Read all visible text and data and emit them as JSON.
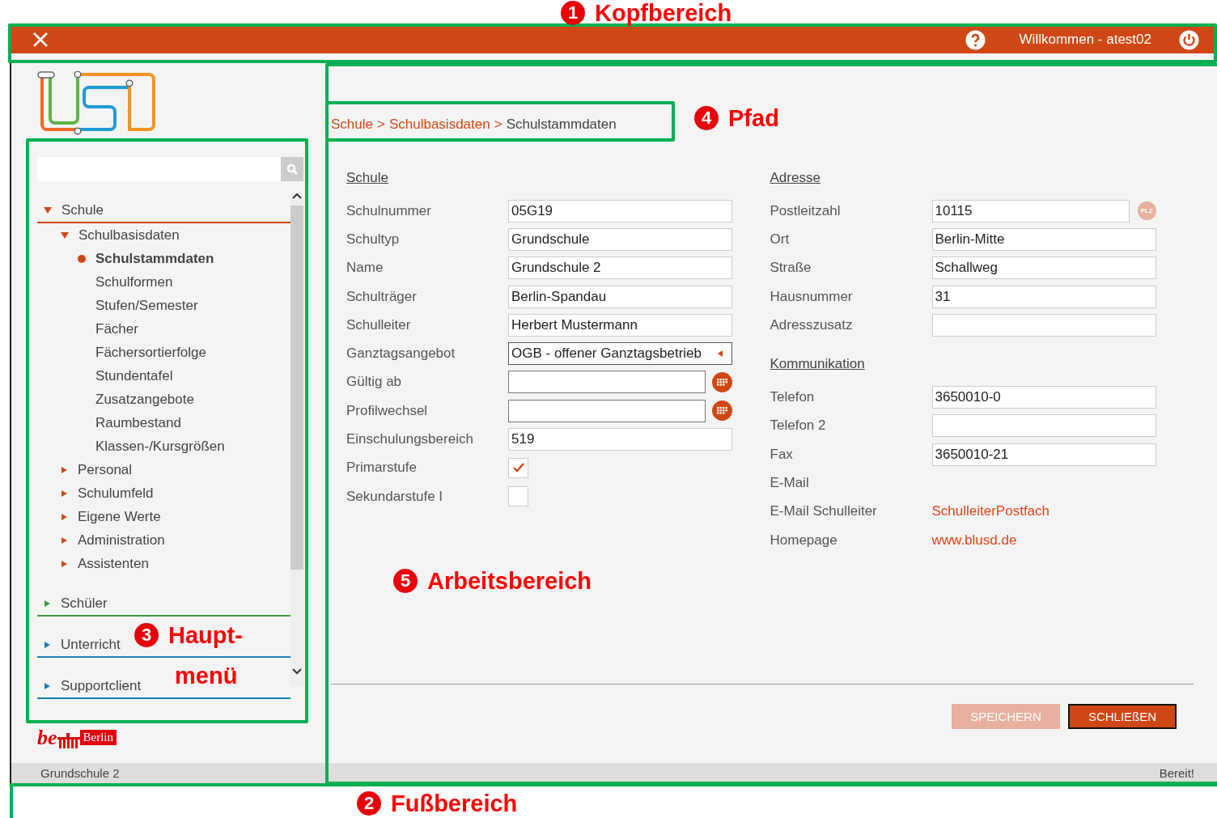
{
  "header": {
    "welcome": "Willkommen - atest02"
  },
  "sidebar": {
    "tree": [
      {
        "label": "Schule",
        "color": "#d04716",
        "expanded": true,
        "selected": false,
        "children": [
          {
            "label": "Schulbasisdaten",
            "expanded": true,
            "selected": false,
            "children": [
              {
                "label": "Schulstammdaten",
                "selected": true
              },
              {
                "label": "Schulformen",
                "selected": false
              },
              {
                "label": "Stufen/Semester",
                "selected": false
              },
              {
                "label": "Fächer",
                "selected": false
              },
              {
                "label": "Fächersortierfolge",
                "selected": false
              },
              {
                "label": "Stundentafel",
                "selected": false
              },
              {
                "label": "Zusatzangebote",
                "selected": false
              },
              {
                "label": "Raumbestand",
                "selected": false
              },
              {
                "label": "Klassen-/Kursgrößen",
                "selected": false
              }
            ]
          },
          {
            "label": "Personal",
            "expanded": false,
            "selected": false
          },
          {
            "label": "Schulumfeld",
            "expanded": false,
            "selected": false
          },
          {
            "label": "Eigene Werte",
            "expanded": false,
            "selected": false
          },
          {
            "label": "Administration",
            "expanded": false,
            "selected": false
          },
          {
            "label": "Assistenten",
            "expanded": false,
            "selected": false
          }
        ]
      },
      {
        "label": "Schüler",
        "color": "#3a9a3f",
        "expanded": false,
        "selected": false
      },
      {
        "label": "Unterricht",
        "color": "#1a7fad",
        "expanded": false,
        "selected": false
      },
      {
        "label": "Supportclient",
        "color": "#1a7fad",
        "expanded": false,
        "selected": false
      }
    ],
    "berlin_logo": {
      "mark": "be",
      "text": "Berlin"
    }
  },
  "breadcrumb": {
    "separator": ">",
    "items": [
      {
        "label": "Schule",
        "current": false
      },
      {
        "label": "Schulbasisdaten",
        "current": false
      },
      {
        "label": "Schulstammdaten",
        "current": true
      }
    ]
  },
  "form": {
    "columns": [
      {
        "sections": [
          {
            "heading": "Schule",
            "fields": [
              {
                "kind": "text",
                "label": "Schulnummer",
                "value": "05G19"
              },
              {
                "kind": "text",
                "label": "Schultyp",
                "value": "Grundschule"
              },
              {
                "kind": "text",
                "label": "Name",
                "value": "Grundschule 2"
              },
              {
                "kind": "text",
                "label": "Schulträger",
                "value": "Berlin-Spandau"
              },
              {
                "kind": "text",
                "label": "Schulleiter",
                "value": "Herbert Mustermann"
              },
              {
                "kind": "select",
                "label": "Ganztagsangebot",
                "value": "OGB - offener Ganztagsbetrieb"
              },
              {
                "kind": "date",
                "label": "Gültig ab"
              },
              {
                "kind": "date",
                "label": "Profilwechsel"
              },
              {
                "kind": "text",
                "label": "Einschulungsbereich",
                "value": "519"
              },
              {
                "kind": "checkbox",
                "label": "Primarstufe",
                "checked": true
              },
              {
                "kind": "checkbox",
                "label": "Sekundarstufe I",
                "checked": false
              }
            ]
          }
        ]
      },
      {
        "sections": [
          {
            "heading": "Adresse",
            "fields": [
              {
                "kind": "plz",
                "label": "Postleitzahl",
                "value": "10115",
                "badge": "PLZ"
              },
              {
                "kind": "text",
                "label": "Ort",
                "value": "Berlin-Mitte"
              },
              {
                "kind": "text",
                "label": "Straße",
                "value": "Schallweg"
              },
              {
                "kind": "text",
                "label": "Hausnummer",
                "value": "31"
              },
              {
                "kind": "text",
                "label": "Adresszusatz"
              }
            ]
          },
          {
            "heading": "Kommunikation",
            "fields": [
              {
                "kind": "text",
                "label": "Telefon",
                "value": "3650010-0"
              },
              {
                "kind": "text",
                "label": "Telefon 2"
              },
              {
                "kind": "text",
                "label": "Fax",
                "value": "3650010-21"
              },
              {
                "kind": "none",
                "label": "E-Mail"
              },
              {
                "kind": "link",
                "label": "E-Mail Schulleiter",
                "value": "SchulleiterPostfach"
              },
              {
                "kind": "link",
                "label": "Homepage",
                "value": "www.blusd.de"
              }
            ]
          }
        ]
      }
    ]
  },
  "buttons": [
    {
      "label": "SPEICHERN",
      "disabled": true
    },
    {
      "label": "SCHLIEßEN",
      "disabled": false
    }
  ],
  "status_bar": {
    "left": "Grundschule 2",
    "right": "Bereit!"
  },
  "annotations": [
    {
      "number": "1",
      "lines": [
        "Kopfbereich"
      ]
    },
    {
      "number": "2",
      "lines": [
        "Fußbereich"
      ]
    },
    {
      "number": "3",
      "lines": [
        "Haupt-",
        "menü"
      ]
    },
    {
      "number": "4",
      "lines": [
        "Pfad"
      ]
    },
    {
      "number": "5",
      "lines": [
        "Arbeitsbereich"
      ]
    }
  ]
}
